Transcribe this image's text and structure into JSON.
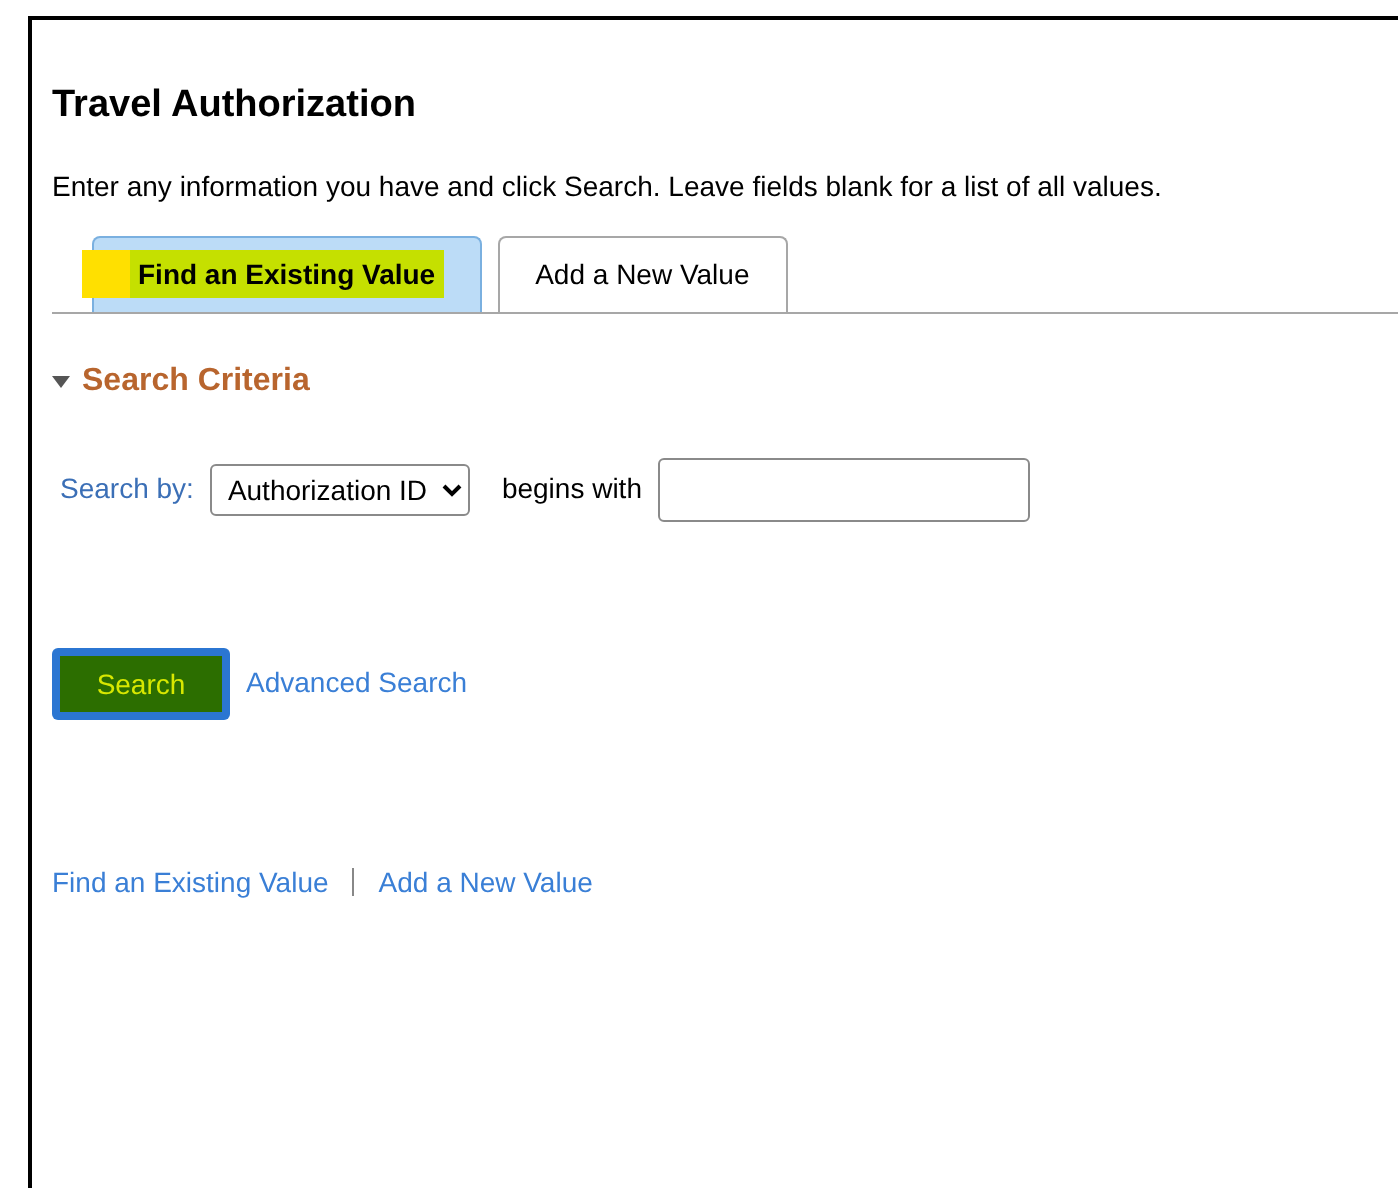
{
  "page_title": "Travel Authorization",
  "instructions": "Enter any information you have and click Search. Leave fields blank for a list of all values.",
  "tabs": [
    {
      "label": "Find an Existing Value",
      "selected": true,
      "highlighted": true
    },
    {
      "label": "Add a New Value",
      "selected": false,
      "highlighted": false
    }
  ],
  "section": {
    "title": "Search Criteria",
    "expanded": true
  },
  "search_by": {
    "label": "Search by:",
    "value": "Authorization ID",
    "operator": "begins with"
  },
  "search_button": {
    "label": "Search",
    "highlighted": true
  },
  "advanced_link": "Advanced Search",
  "footer_links": [
    "Find an Existing Value",
    "Add a New Value"
  ]
}
